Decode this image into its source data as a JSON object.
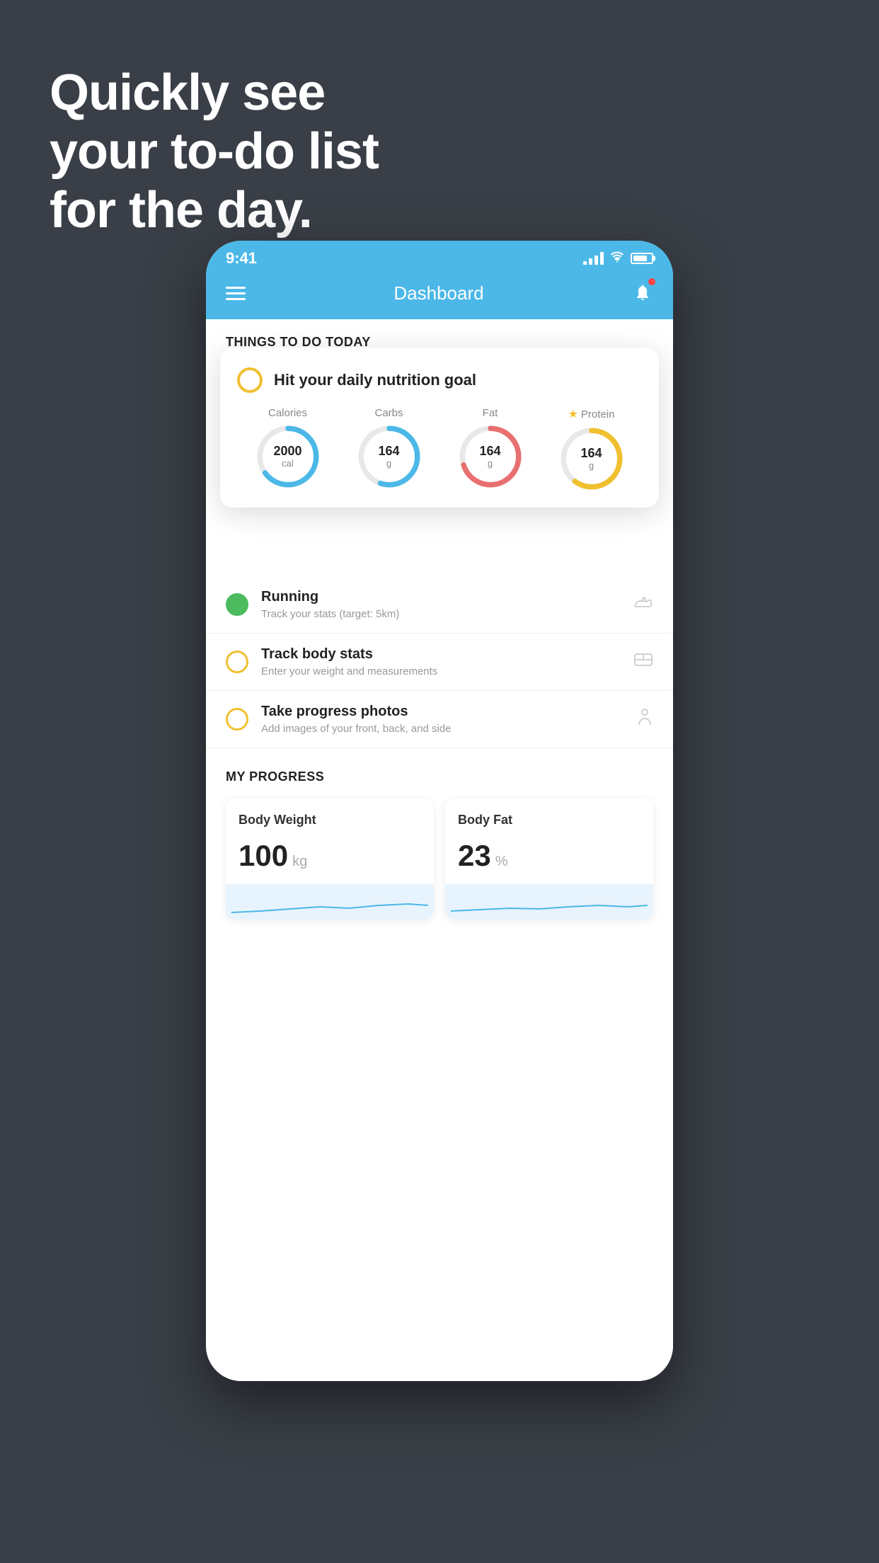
{
  "headline": {
    "line1": "Quickly see",
    "line2": "your to-do list",
    "line3": "for the day."
  },
  "status_bar": {
    "time": "9:41"
  },
  "header": {
    "title": "Dashboard"
  },
  "section": {
    "things_todo": "THINGS TO DO TODAY"
  },
  "floating_card": {
    "title": "Hit your daily nutrition goal",
    "nutrition": [
      {
        "label": "Calories",
        "value": "2000",
        "unit": "cal",
        "color": "#4cb8e8",
        "track_pct": 65
      },
      {
        "label": "Carbs",
        "value": "164",
        "unit": "g",
        "color": "#4cb8e8",
        "track_pct": 55
      },
      {
        "label": "Fat",
        "value": "164",
        "unit": "g",
        "color": "#e87070",
        "track_pct": 70
      },
      {
        "label": "Protein",
        "value": "164",
        "unit": "g",
        "color": "#f0c030",
        "track_pct": 60,
        "starred": true
      }
    ]
  },
  "todo_items": [
    {
      "title": "Running",
      "subtitle": "Track your stats (target: 5km)",
      "status": "green",
      "icon": "shoe"
    },
    {
      "title": "Track body stats",
      "subtitle": "Enter your weight and measurements",
      "status": "yellow",
      "icon": "scale"
    },
    {
      "title": "Take progress photos",
      "subtitle": "Add images of your front, back, and side",
      "status": "yellow",
      "icon": "person"
    }
  ],
  "progress_section": {
    "title": "MY PROGRESS",
    "cards": [
      {
        "title": "Body Weight",
        "value": "100",
        "unit": "kg"
      },
      {
        "title": "Body Fat",
        "value": "23",
        "unit": "%"
      }
    ]
  }
}
